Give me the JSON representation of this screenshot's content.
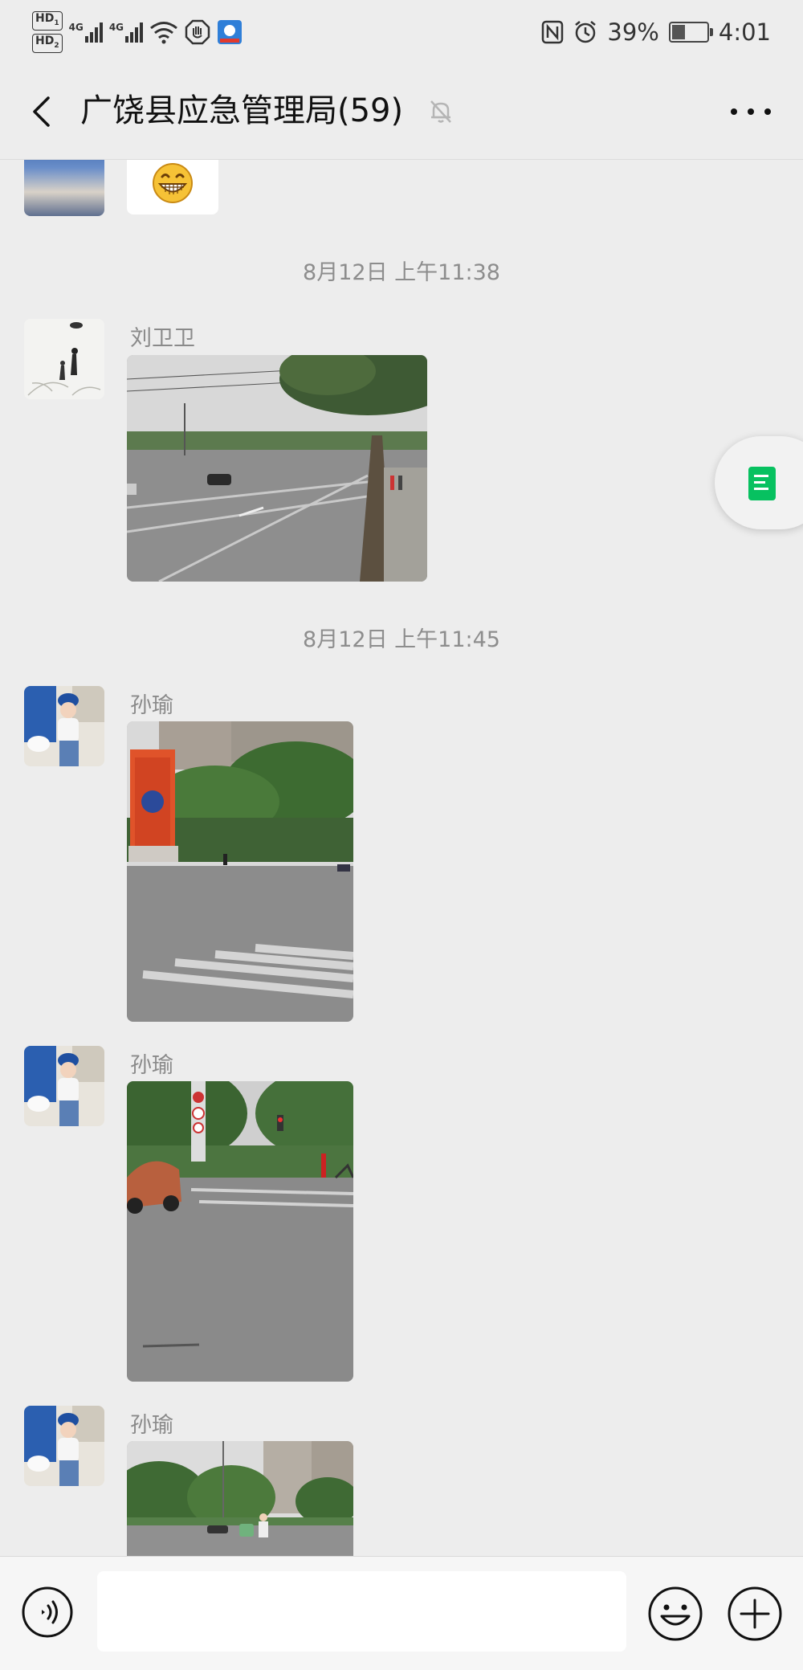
{
  "status_bar": {
    "hd1": "HD",
    "hd1_sub": "1",
    "hd2": "HD",
    "hd2_sub": "2",
    "net1": "4G",
    "net2": "4G",
    "nfc": "N",
    "battery_percent": "39%",
    "battery_level": 0.39,
    "time": "4:01"
  },
  "header": {
    "title": "广饶县应急管理局(59)"
  },
  "messages": [
    {
      "type": "timestamp",
      "text": "8月12日 上午11:38"
    },
    {
      "type": "image",
      "sender": "刘卫卫",
      "scene": "street-intersection-tree"
    },
    {
      "type": "timestamp",
      "text": "8月12日 上午11:45"
    },
    {
      "type": "image",
      "sender": "孙瑜",
      "scene": "monument-crosswalk"
    },
    {
      "type": "image",
      "sender": "孙瑜",
      "scene": "car-traffic-light"
    },
    {
      "type": "image",
      "sender": "孙瑜",
      "scene": "road-buildings"
    }
  ],
  "input": {
    "value": "",
    "placeholder": ""
  },
  "colors": {
    "background": "#ededed",
    "accent": "#07c160",
    "timestamp": "#8d8d8d"
  },
  "icons": [
    "back-arrow-icon",
    "mute-bell-icon",
    "more-icon",
    "document-icon",
    "voice-icon",
    "emoji-icon",
    "plus-icon"
  ]
}
